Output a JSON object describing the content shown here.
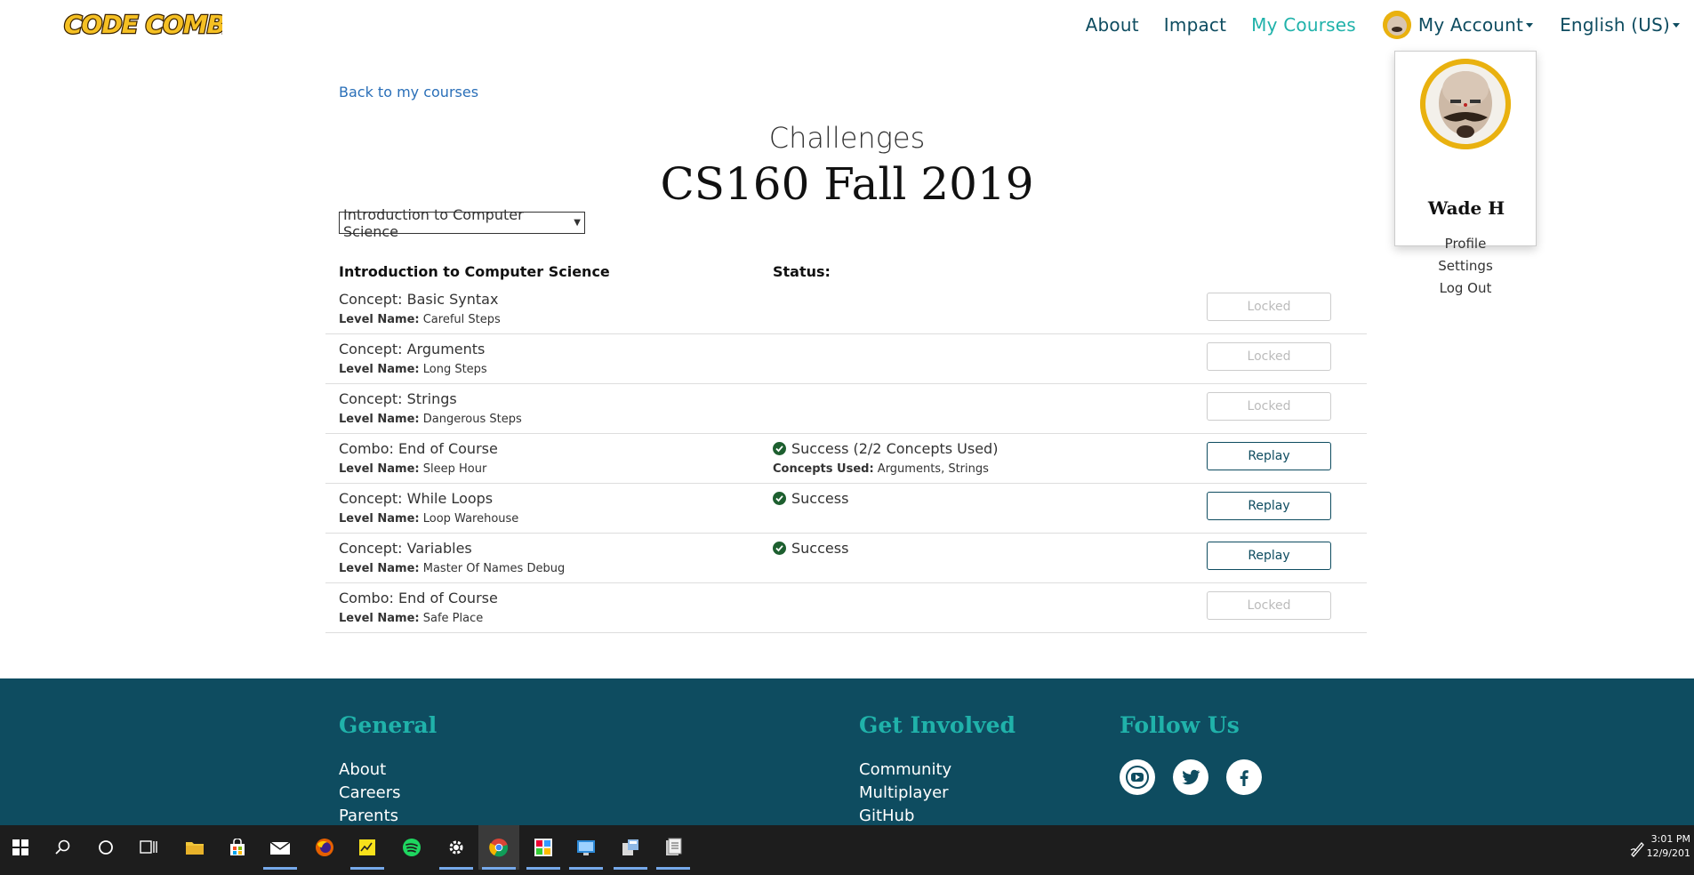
{
  "navbar": {
    "logo_text": "CODE COMBAT",
    "links": [
      "About",
      "Impact",
      "My Courses"
    ],
    "account_label": "My Account",
    "language_label": "English (US)"
  },
  "account_menu": {
    "name": "Wade H",
    "items": [
      "Profile",
      "Settings",
      "Log Out"
    ]
  },
  "content": {
    "back_link": "Back to my courses",
    "heading": "Challenges",
    "class_name": "CS160 Fall 2019",
    "course_select": "Introduction to Computer Science",
    "table_header_course": "Introduction to Computer Science",
    "table_header_status": "Status:",
    "level_name_label": "Level Name:",
    "concepts_used_label": "Concepts Used:",
    "levels": [
      {
        "concept": "Concept: Basic Syntax",
        "level_name": "Careful Steps",
        "status": "",
        "concepts_used": "",
        "button": "Locked"
      },
      {
        "concept": "Concept: Arguments",
        "level_name": "Long Steps",
        "status": "",
        "concepts_used": "",
        "button": "Locked"
      },
      {
        "concept": "Concept: Strings",
        "level_name": "Dangerous Steps",
        "status": "",
        "concepts_used": "",
        "button": "Locked"
      },
      {
        "concept": "Combo: End of Course",
        "level_name": "Sleep Hour",
        "status": "Success (2/2 Concepts Used)",
        "concepts_used": "Arguments, Strings",
        "button": "Replay"
      },
      {
        "concept": "Concept: While Loops",
        "level_name": "Loop Warehouse",
        "status": "Success",
        "concepts_used": "",
        "button": "Replay"
      },
      {
        "concept": "Concept: Variables",
        "level_name": "Master Of Names Debug",
        "status": "Success",
        "concepts_used": "",
        "button": "Replay"
      },
      {
        "concept": "Combo: End of Course",
        "level_name": "Safe Place",
        "status": "",
        "concepts_used": "",
        "button": "Locked"
      }
    ]
  },
  "footer": {
    "general_heading": "General",
    "general_links": [
      "About",
      "Careers",
      "Parents"
    ],
    "involved_heading": "Get Involved",
    "involved_links": [
      "Community",
      "Multiplayer",
      "GitHub"
    ],
    "follow_heading": "Follow Us",
    "social_icons": [
      "youtube-icon",
      "twitter-icon",
      "facebook-icon"
    ]
  },
  "taskbar": {
    "time": "3:01 PM",
    "date": "12/9/201"
  },
  "colors": {
    "brand_teal": "#0e4c60",
    "accent": "#20b2aa",
    "success": "#1d5f2f",
    "link": "#2a6fb8"
  }
}
